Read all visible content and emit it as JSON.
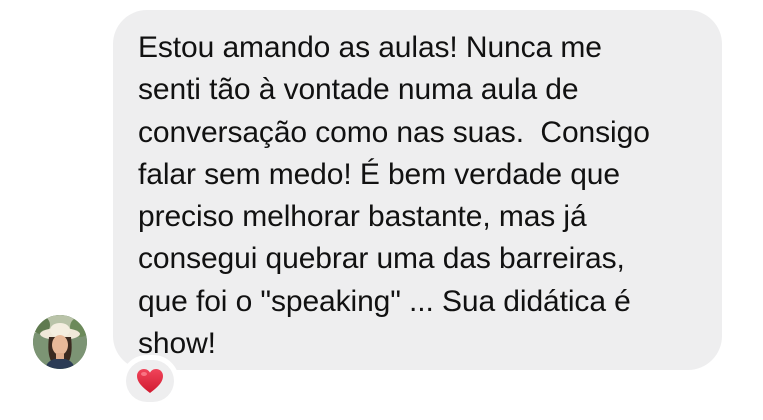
{
  "message": {
    "lines": [
      "Estou amando as aulas! Nunca me",
      "senti tão à vontade numa aula de",
      "conversação como nas suas.  Consigo",
      "falar sem medo! É bem verdade que",
      "preciso melhorar bastante, mas já",
      "consegui quebrar uma das barreiras,",
      "que foi o \"speaking\" ... Sua didática é",
      "show!"
    ]
  },
  "sender": {
    "avatar_icon": "profile-photo"
  },
  "reaction": {
    "icon": "red-heart-icon",
    "color": "#e5243b"
  },
  "colors": {
    "bubble": "#eeeeef",
    "text": "#111111",
    "background": "#ffffff"
  }
}
